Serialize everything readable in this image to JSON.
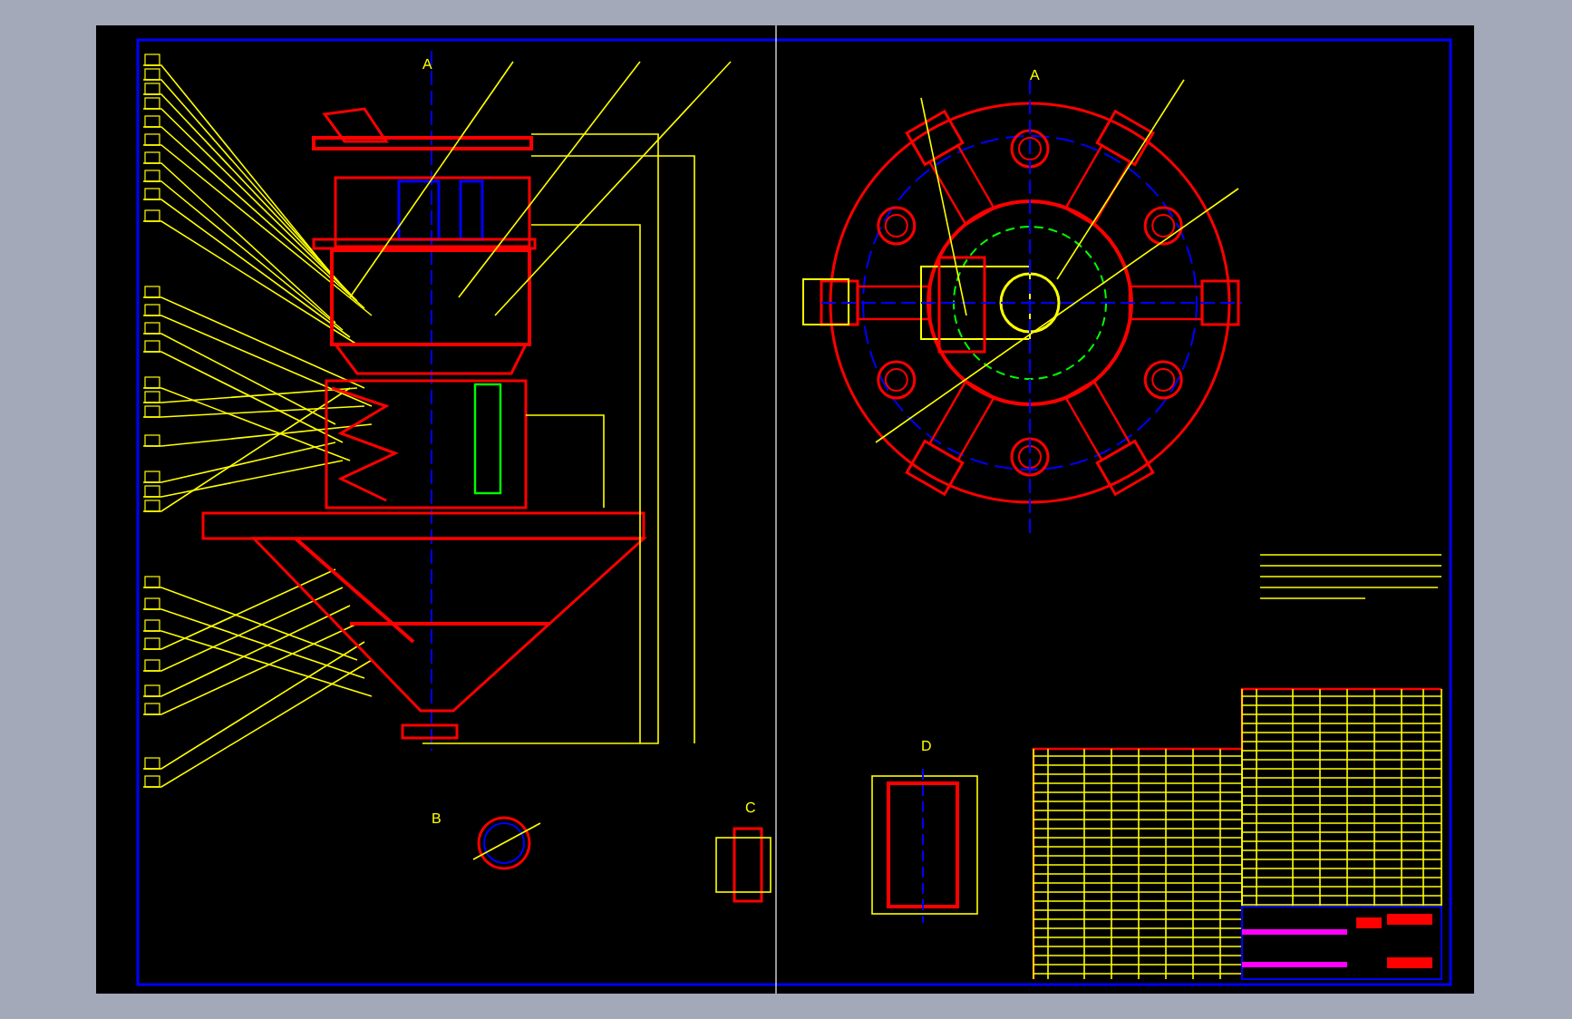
{
  "section_labels": [
    {
      "text": "A"
    },
    {
      "text": "A"
    },
    {
      "text": "B"
    },
    {
      "text": "C"
    },
    {
      "text": "D"
    }
  ]
}
